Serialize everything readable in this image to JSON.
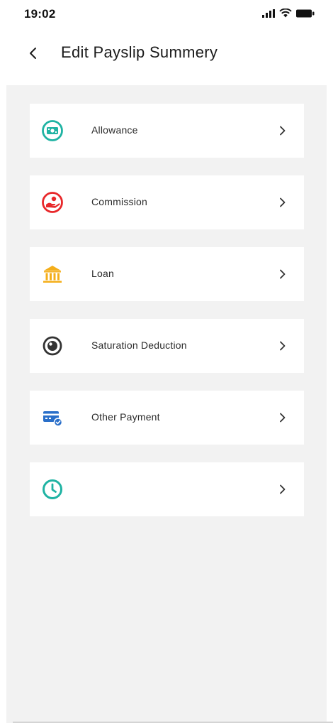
{
  "status_bar": {
    "time": "19:02",
    "icons": [
      "signal-icon",
      "wifi-icon",
      "battery-icon"
    ]
  },
  "header": {
    "back_icon": "chevron-left-icon",
    "title": "Edit Payslip Summery"
  },
  "items": [
    {
      "label": "Allowance",
      "icon": "money-icon",
      "color": "#1fb3a3"
    },
    {
      "label": "Commission",
      "icon": "commission-hand-icon",
      "color": "#e8282b"
    },
    {
      "label": "Loan",
      "icon": "bank-icon",
      "color": "#f4ae1a"
    },
    {
      "label": "Saturation Deduction",
      "icon": "deduction-icon",
      "color": "#333333"
    },
    {
      "label": "Other Payment",
      "icon": "card-payment-icon",
      "color": "#2a6fc9"
    },
    {
      "label": "",
      "icon": "clock-icon",
      "color": "#1fb3a3"
    }
  ],
  "chevron_icon": "chevron-right-icon",
  "colors": {
    "background": "#f2f2f2",
    "card": "#ffffff",
    "text": "#2a2a2a"
  }
}
